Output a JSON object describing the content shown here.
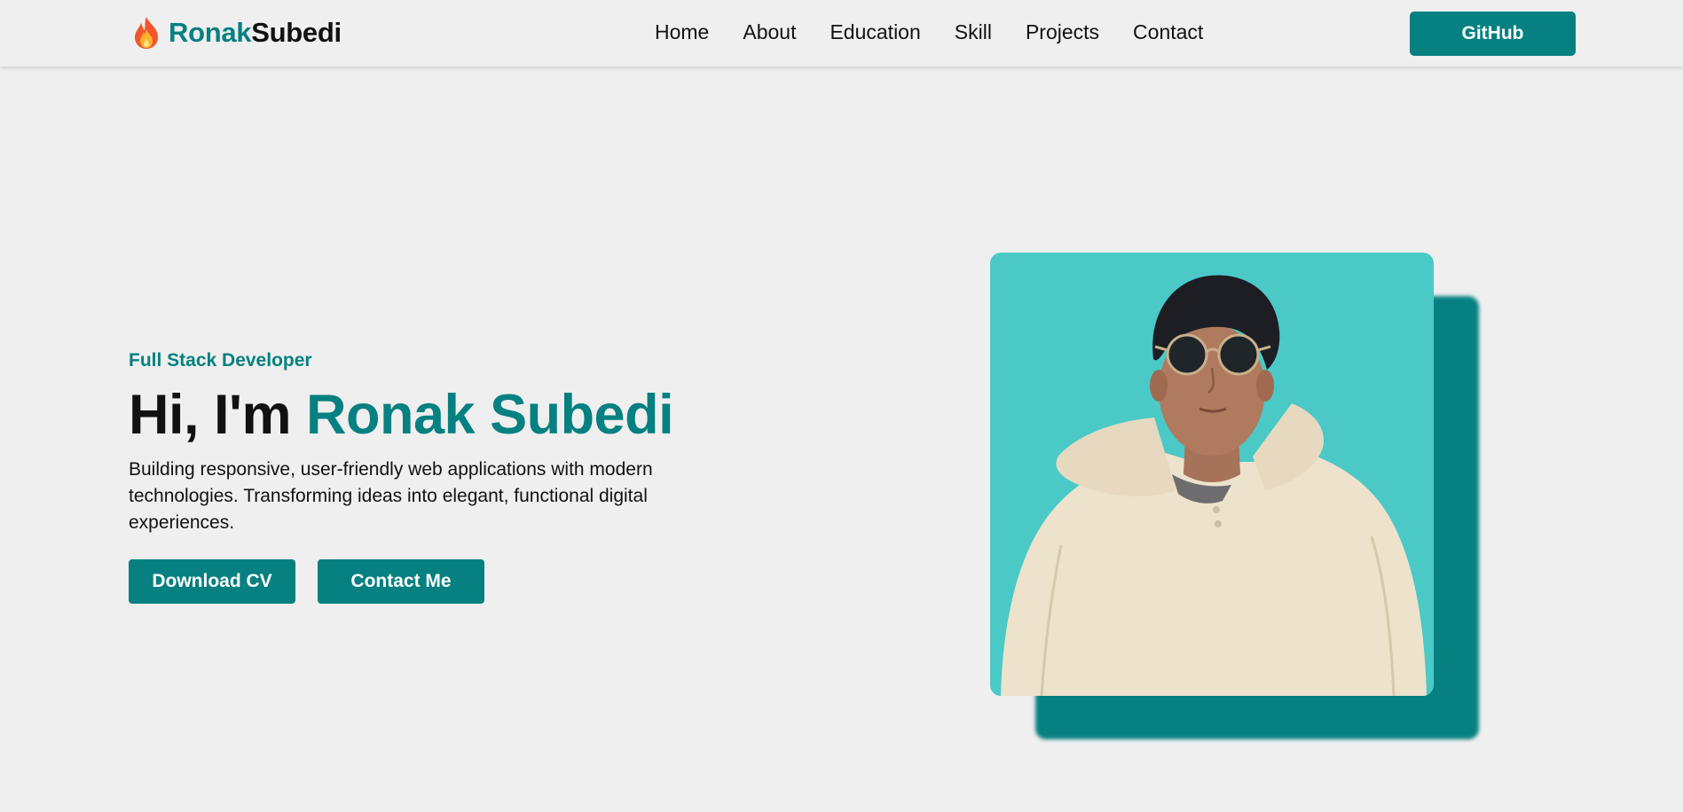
{
  "header": {
    "logo": {
      "icon": "fire-icon",
      "first": "Ronak",
      "last": "Subedi"
    },
    "nav": [
      "Home",
      "About",
      "Education",
      "Skill",
      "Projects",
      "Contact"
    ],
    "github_label": "GitHub"
  },
  "hero": {
    "subtitle": "Full Stack Developer",
    "headline_prefix": "Hi, I'm",
    "headline_name": "Ronak Subedi",
    "description": "Building responsive, user-friendly web applications with modern technologies. Transforming ideas into elegant, functional digital experiences.",
    "buttons": {
      "download": "Download CV",
      "contact": "Contact Me"
    },
    "portrait": "profile-photo"
  },
  "colors": {
    "accent": "#068080",
    "photo_bg": "#4ac9c7",
    "page_bg": "#efefef"
  }
}
